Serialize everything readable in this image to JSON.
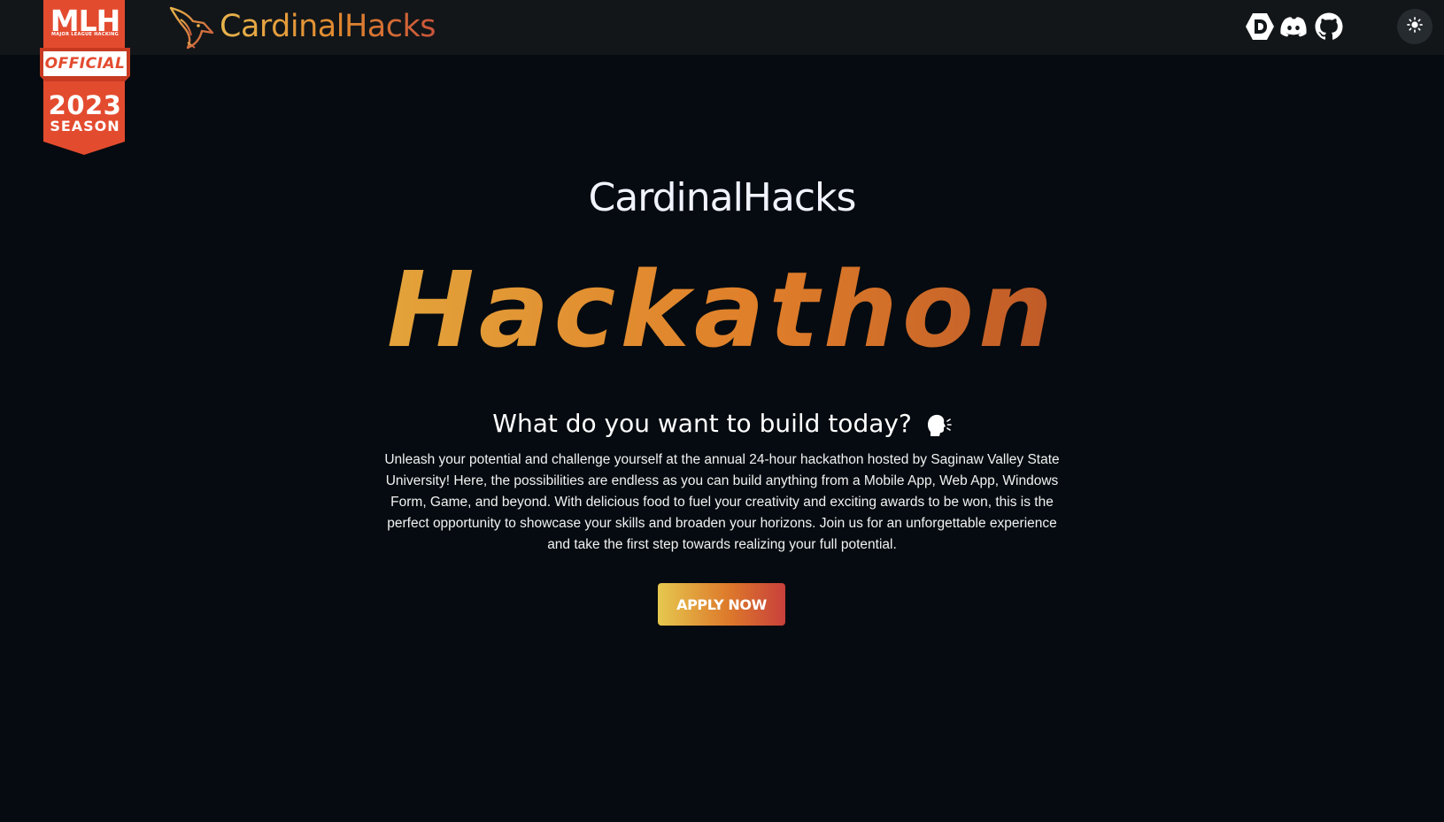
{
  "nav": {
    "brand_name": "CardinalHacks",
    "brand_logo_icon": "cardinal-bird-logo",
    "social_links": [
      {
        "icon": "devpost-icon"
      },
      {
        "icon": "discord-icon"
      },
      {
        "icon": "github-icon"
      }
    ],
    "theme_toggle_icon": "sun-icon"
  },
  "mlh_badge": {
    "logo": "MLH",
    "small_text": "MAJOR LEAGUE HACKING",
    "label": "OFFICIAL",
    "year": "2023",
    "season": "SEASON",
    "color": "#e34b2f"
  },
  "hero": {
    "site_title": "CardinalHacks",
    "headline": "Hackathon",
    "question": "What do you want to build today?",
    "question_icon": "speaking-head-icon",
    "description": "Unleash your potential and challenge yourself at the annual 24-hour hackathon hosted by Saginaw Valley State University! Here, the possibilities are endless as you can build anything from a Mobile App, Web App, Windows Form, Game, and beyond. With delicious food to fuel your creativity and exciting awards to be won, this is the perfect opportunity to showcase your skills and broaden your horizons. Join us for an unforgettable experience and take the first step towards realizing your full potential.",
    "cta_label": "APPLY NOW"
  },
  "colors": {
    "background": "#050b10",
    "navbar": "#121619",
    "accent_gold": "#e3a33a",
    "accent_orange": "#e07f2a",
    "accent_red": "#c8403b"
  }
}
